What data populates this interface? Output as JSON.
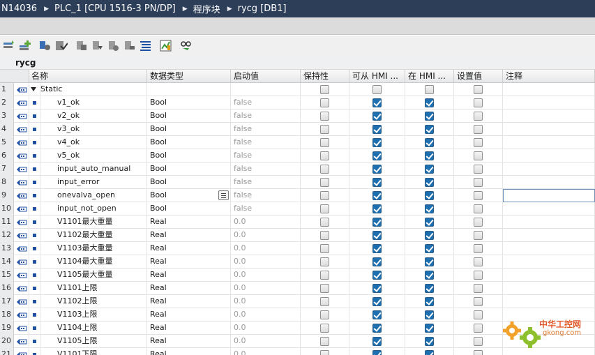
{
  "breadcrumb": {
    "project": "N14036",
    "plc": "PLC_1 [CPU 1516-3 PN/DP]",
    "folder": "程序块",
    "block": "rycg [DB1]"
  },
  "toolbar": {
    "buttons": [
      "insert-row-icon",
      "add-row-icon",
      "expand-icon",
      "reset-icon",
      "snapshot-icon",
      "load-snapshot-icon",
      "copy-snapshot-icon",
      "load-start-icon",
      "list-icon",
      "monitor-icon",
      "glasses-icon"
    ]
  },
  "block_title": "rycg",
  "columns": {
    "name": "名称",
    "datatype": "数据类型",
    "start": "启动值",
    "retain": "保持性",
    "hmi_access": "可从 HMI ...",
    "hmi_visible": "在 HMI ...",
    "setpoint": "设置值",
    "comment": "注释"
  },
  "rows": [
    {
      "num": "1",
      "name": "Static",
      "type": "",
      "start": "",
      "retain": false,
      "hmi1": false,
      "hmi2": false,
      "set": false
    },
    {
      "num": "2",
      "name": "v1_ok",
      "type": "Bool",
      "start": "false",
      "retain": false,
      "hmi1": true,
      "hmi2": true,
      "set": false
    },
    {
      "num": "3",
      "name": "v2_ok",
      "type": "Bool",
      "start": "false",
      "retain": false,
      "hmi1": true,
      "hmi2": true,
      "set": false
    },
    {
      "num": "4",
      "name": "v3_ok",
      "type": "Bool",
      "start": "false",
      "retain": false,
      "hmi1": true,
      "hmi2": true,
      "set": false
    },
    {
      "num": "5",
      "name": "v4_ok",
      "type": "Bool",
      "start": "false",
      "retain": false,
      "hmi1": true,
      "hmi2": true,
      "set": false
    },
    {
      "num": "6",
      "name": "v5_ok",
      "type": "Bool",
      "start": "false",
      "retain": false,
      "hmi1": true,
      "hmi2": true,
      "set": false
    },
    {
      "num": "7",
      "name": "input_auto_manual",
      "type": "Bool",
      "start": "false",
      "retain": false,
      "hmi1": true,
      "hmi2": true,
      "set": false
    },
    {
      "num": "8",
      "name": "input_error",
      "type": "Bool",
      "start": "false",
      "retain": false,
      "hmi1": true,
      "hmi2": true,
      "set": false
    },
    {
      "num": "9",
      "name": "onevalva_open",
      "type": "Bool",
      "start": "false",
      "retain": false,
      "hmi1": true,
      "hmi2": true,
      "set": false
    },
    {
      "num": "10",
      "name": "input_not_open",
      "type": "Bool",
      "start": "false",
      "retain": false,
      "hmi1": true,
      "hmi2": true,
      "set": false
    },
    {
      "num": "11",
      "name": "V1101最大重量",
      "type": "Real",
      "start": "0.0",
      "retain": false,
      "hmi1": true,
      "hmi2": true,
      "set": false
    },
    {
      "num": "12",
      "name": "V1102最大重量",
      "type": "Real",
      "start": "0.0",
      "retain": false,
      "hmi1": true,
      "hmi2": true,
      "set": false
    },
    {
      "num": "13",
      "name": "V1103最大重量",
      "type": "Real",
      "start": "0.0",
      "retain": false,
      "hmi1": true,
      "hmi2": true,
      "set": false
    },
    {
      "num": "14",
      "name": "V1104最大重量",
      "type": "Real",
      "start": "0.0",
      "retain": false,
      "hmi1": true,
      "hmi2": true,
      "set": false
    },
    {
      "num": "15",
      "name": "V1105最大重量",
      "type": "Real",
      "start": "0.0",
      "retain": false,
      "hmi1": true,
      "hmi2": true,
      "set": false
    },
    {
      "num": "16",
      "name": "V1101上限",
      "type": "Real",
      "start": "0.0",
      "retain": false,
      "hmi1": true,
      "hmi2": true,
      "set": false
    },
    {
      "num": "17",
      "name": "V1102上限",
      "type": "Real",
      "start": "0.0",
      "retain": false,
      "hmi1": true,
      "hmi2": true,
      "set": false
    },
    {
      "num": "18",
      "name": "V1103上限",
      "type": "Real",
      "start": "0.0",
      "retain": false,
      "hmi1": true,
      "hmi2": true,
      "set": false
    },
    {
      "num": "19",
      "name": "V1104上限",
      "type": "Real",
      "start": "0.0",
      "retain": false,
      "hmi1": true,
      "hmi2": true,
      "set": false
    },
    {
      "num": "20",
      "name": "V1105上限",
      "type": "Real",
      "start": "0.0",
      "retain": false,
      "hmi1": true,
      "hmi2": true,
      "set": false
    },
    {
      "num": "21",
      "name": "V1101下限",
      "type": "Real",
      "start": "0.0",
      "retain": false,
      "hmi1": true,
      "hmi2": true,
      "set": false
    }
  ],
  "watermark": {
    "line1": "中华工控网",
    "line2": "gkong.com"
  },
  "colors": {
    "titlebar": "#2d3e58",
    "checkbox_on": "#1d6fb0",
    "db_icon": "#2150a0"
  }
}
